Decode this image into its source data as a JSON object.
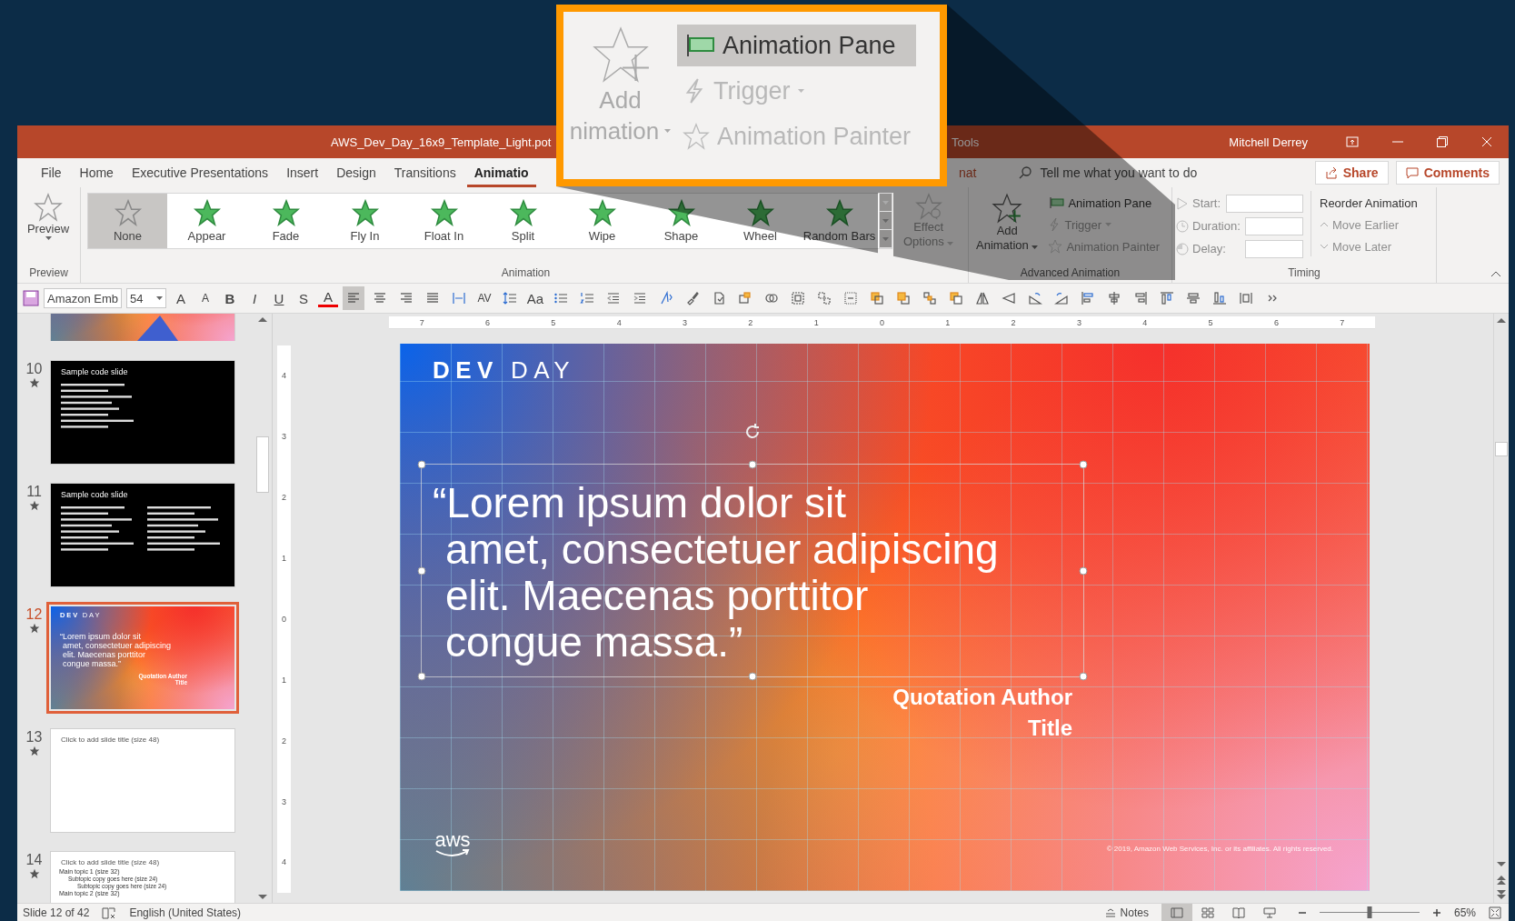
{
  "callout": {
    "add_animation": [
      "Add",
      "nimation"
    ],
    "items": [
      {
        "label": "Animation Pane",
        "selected": true,
        "disabled": false
      },
      {
        "label": "Trigger",
        "selected": false,
        "disabled": true
      },
      {
        "label": "Animation Painter",
        "selected": false,
        "disabled": true
      }
    ]
  },
  "title_bar": {
    "title": "AWS_Dev_Day_16x9_Template_Light.pot",
    "context_tab": "Tools",
    "user": "Mitchell Derrey"
  },
  "tabs": [
    {
      "label": "File",
      "selected": false
    },
    {
      "label": "Home",
      "selected": false
    },
    {
      "label": "Executive Presentations",
      "selected": false
    },
    {
      "label": "Insert",
      "selected": false
    },
    {
      "label": "Design",
      "selected": false
    },
    {
      "label": "Transitions",
      "selected": false
    },
    {
      "label": "Animatio",
      "selected": true
    },
    {
      "label": "nat",
      "selected": false
    }
  ],
  "search": {
    "placeholder": "Tell me what you want to do"
  },
  "share": "Share",
  "comments": "Comments",
  "ribbon": {
    "preview": {
      "button": "Preview",
      "group": "Preview"
    },
    "animation": {
      "group": "Animation",
      "effect_options": [
        "Effect",
        "Options"
      ],
      "effects": [
        {
          "label": "None",
          "kind": "none",
          "selected": true
        },
        {
          "label": "Appear",
          "kind": "effect",
          "selected": false
        },
        {
          "label": "Fade",
          "kind": "effect",
          "selected": false
        },
        {
          "label": "Fly In",
          "kind": "effect",
          "selected": false
        },
        {
          "label": "Float In",
          "kind": "effect",
          "selected": false
        },
        {
          "label": "Split",
          "kind": "effect",
          "selected": false
        },
        {
          "label": "Wipe",
          "kind": "effect",
          "selected": false
        },
        {
          "label": "Shape",
          "kind": "effect",
          "selected": false
        },
        {
          "label": "Wheel",
          "kind": "effect",
          "selected": false
        },
        {
          "label": "Random Bars",
          "kind": "effect",
          "selected": false
        }
      ]
    },
    "advanced": {
      "group": "Advanced Animation",
      "add": [
        "Add",
        "Animation"
      ],
      "items": [
        {
          "label": "Animation Pane",
          "disabled": false
        },
        {
          "label": "Trigger",
          "disabled": true
        },
        {
          "label": "Animation Painter",
          "disabled": true
        }
      ]
    },
    "timing": {
      "group": "Timing",
      "fields": [
        "Start:",
        "Duration:",
        "Delay:"
      ],
      "reorder": "Reorder Animation",
      "moves": [
        "Move Earlier",
        "Move Later"
      ]
    }
  },
  "format_bar": {
    "font": "Amazon Emb",
    "size": "54",
    "chars": [
      "A",
      "A",
      "B",
      "I",
      "U",
      "S",
      "A"
    ],
    "spacing": "AV",
    "case": "Aa",
    "align": [
      {
        "selected": true
      },
      {
        "selected": false
      },
      {
        "selected": false
      },
      {
        "selected": false
      }
    ]
  },
  "slides": [
    {
      "kind": "partial",
      "selected": false,
      "has_animation": false
    },
    {
      "number": "10",
      "kind": "code",
      "selected": false,
      "has_animation": true,
      "title": "Sample code slide"
    },
    {
      "number": "11",
      "kind": "code2",
      "selected": false,
      "has_animation": true,
      "title": "Sample code slide"
    },
    {
      "number": "12",
      "kind": "quote",
      "selected": true,
      "has_animation": true,
      "brand": [
        "DEV",
        "DAY"
      ],
      "quote_lines": [
        "“Lorem ipsum dolor sit",
        "amet, consectetuer adipiscing",
        "elit. Maecenas porttitor",
        "congue massa.”"
      ],
      "author": [
        "Quotation Author",
        "Title"
      ]
    },
    {
      "number": "13",
      "kind": "title",
      "selected": false,
      "has_animation": true,
      "title": "Click to add slide title (size 48)"
    },
    {
      "number": "14",
      "kind": "bullets",
      "selected": false,
      "has_animation": true,
      "title": "Click to add slide title (size 48)",
      "bullets": [
        {
          "text": "Main topic 1 (size 32)",
          "children": [
            {
              "text": "Subtopic copy goes here (size 24)",
              "children": [
                {
                  "text": "Subtopic copy goes here (size 24)"
                }
              ]
            }
          ]
        },
        {
          "text": "Main topic 2 (size 32)"
        }
      ]
    }
  ],
  "rulers": {
    "horizontal": [
      "7",
      "6",
      "5",
      "4",
      "3",
      "2",
      "1",
      "0",
      "1",
      "2",
      "3",
      "4",
      "5",
      "6",
      "7"
    ],
    "vertical": [
      "4",
      "3",
      "2",
      "1",
      "0",
      "1",
      "2",
      "3",
      "4"
    ]
  },
  "slide": {
    "brand": [
      "DEV",
      "DAY"
    ],
    "quote_lines": [
      "“Lorem ipsum dolor sit",
      "amet, consectetuer adipiscing",
      "elit. Maecenas porttitor",
      "congue massa.”"
    ],
    "author": [
      "Quotation Author",
      "Title"
    ],
    "logo": "aws",
    "copyright": "© 2019, Amazon Web Services, Inc. or its affiliates. All rights reserved."
  },
  "status_bar": {
    "slide": "Slide 12 of 42",
    "language": "English (United States)",
    "notes": "Notes",
    "views": [
      {
        "selected": true
      },
      {
        "selected": false
      },
      {
        "selected": false
      },
      {
        "selected": false
      }
    ],
    "zoom": {
      "level": 0.5,
      "reading": "65%"
    }
  }
}
